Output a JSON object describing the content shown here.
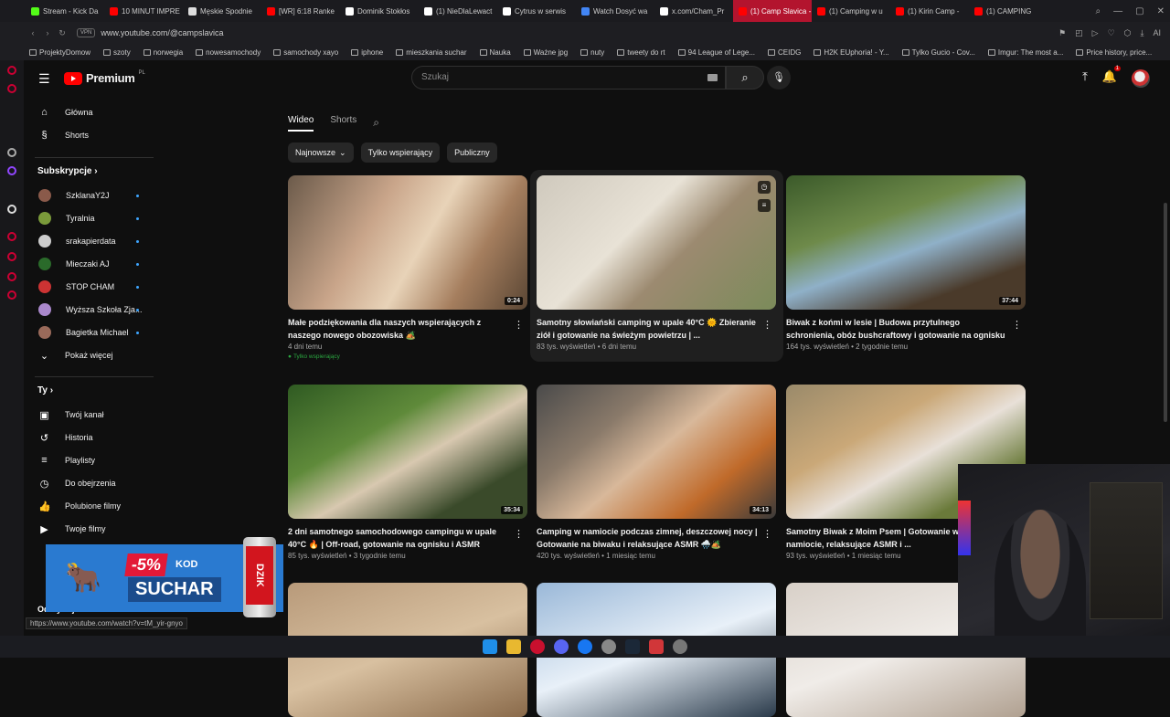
{
  "browser": {
    "tabs": [
      {
        "label": "Stream - Kick Da",
        "color": "#53fc18"
      },
      {
        "label": "10 MINUT IMPRE",
        "color": "#ff0000"
      },
      {
        "label": "Męskie Spodnie",
        "color": "#dddddd"
      },
      {
        "label": "[WR] 6:18 Ranke",
        "color": "#ff0000"
      },
      {
        "label": "Dominik Stokłos",
        "color": "#ffffff"
      },
      {
        "label": "(1) NieDlaLewact",
        "color": "#ffffff"
      },
      {
        "label": "Cytrus w serwis",
        "color": "#ffffff"
      },
      {
        "label": "Watch Dosyć wa",
        "color": "#4285f4"
      },
      {
        "label": "x.com/Cham_Pr",
        "color": "#ffffff"
      },
      {
        "label": "(1) Camp Slavica - YouTube",
        "color": "#ff0000",
        "active": true
      },
      {
        "label": "(1) Camping w u",
        "color": "#ff0000"
      },
      {
        "label": "(1) Kirin Camp -",
        "color": "#ff0000"
      },
      {
        "label": "(1) CAMPING",
        "color": "#ff0000"
      }
    ],
    "vpn": "VPN",
    "url": "www.youtube.com/@campslavica",
    "bookmarks": [
      "ProjektyDomow",
      "szoty",
      "norwegia",
      "nowesamochody",
      "samochody xayo",
      "iphone",
      "mieszkania suchar",
      "Nauka",
      "Ważne jpg",
      "nuty",
      "tweety do rt",
      "94 League of Lege...",
      "CEIDG",
      "H2K EUphoria! - Y...",
      "Tylko Gucio - Cov...",
      "Imgur: The most a...",
      "Price history, price..."
    ],
    "ai_label": "AI",
    "status_url": "https://www.youtube.com/watch?v=tM_yir-gnyo"
  },
  "header": {
    "logo": "Premium",
    "region": "PL",
    "search_placeholder": "Szukaj",
    "notif_count": "1"
  },
  "sidebar": {
    "main": [
      {
        "label": "Główna",
        "icon": "home-icon",
        "glyph": "⌂"
      },
      {
        "label": "Shorts",
        "icon": "shorts-icon",
        "glyph": "§"
      }
    ],
    "subs_title": "Subskrypcje",
    "subs": [
      {
        "label": "SzklanaY2J",
        "color": "#8a5a4a"
      },
      {
        "label": "Tyralnia",
        "color": "#7a9a3a"
      },
      {
        "label": "srakapierdata",
        "color": "#ccc"
      },
      {
        "label": "Mieczaki AJ",
        "color": "#2a6a2a"
      },
      {
        "label": "STOP CHAM",
        "color": "#c33"
      },
      {
        "label": "Wyższa Szkoła Zja...",
        "color": "#aa88cc"
      },
      {
        "label": "Bagietka Michael",
        "color": "#9a6a5a"
      }
    ],
    "more_label": "Pokaż więcej",
    "you_title": "Ty",
    "you": [
      {
        "label": "Twój kanał",
        "icon": "channel-icon",
        "glyph": "▣"
      },
      {
        "label": "Historia",
        "icon": "history-icon",
        "glyph": "↺"
      },
      {
        "label": "Playlisty",
        "icon": "playlist-icon",
        "glyph": "≡"
      },
      {
        "label": "Do obejrzenia",
        "icon": "watch-later-icon",
        "glyph": "◷"
      },
      {
        "label": "Polubione filmy",
        "icon": "like-icon",
        "glyph": "👍"
      },
      {
        "label": "Twoje filmy",
        "icon": "your-videos-icon",
        "glyph": "▶"
      }
    ],
    "bottom_label": "Odkrywaj"
  },
  "channel_tabs": [
    "Wideo",
    "Shorts"
  ],
  "filters": [
    "Najnowsze",
    "Tylko wspierający",
    "Publiczny"
  ],
  "videos": [
    {
      "title": "Małe podziękowania dla naszych wspierających z naszego nowego obozowiska 🏕️",
      "meta": "4 dni temu",
      "duration": "0:24",
      "badge": "Tylko wspierający",
      "bg": "linear-gradient(120deg,#6b5a4a,#c9a58a 35%,#e8d3b8 55%,#a57e5e 75%,#5a4634)"
    },
    {
      "title": "Samotny słowiański camping w upale 40°C 🌞 Zbieranie ziół i gotowanie na świeżym powietrzu | ...",
      "meta": "83 tys. wyświetleń • 6 dni temu",
      "duration": "",
      "badge": "",
      "bg": "linear-gradient(135deg,#cfc9bd,#e8e2d6 40%,#9c8a70 60%,#7b8b5a)"
    },
    {
      "title": "Biwak z końmi w lesie | Budowa przytulnego schronienia, obóz bushcraftowy i gotowanie na ognisku",
      "meta": "164 tys. wyświetleń • 2 tygodnie temu",
      "duration": "37:44",
      "badge": "",
      "bg": "linear-gradient(160deg,#3b5a2a,#6e8a4a 35%,#8fb0c8 55%,#4a3a2a 80%)"
    },
    {
      "title": "2 dni samotnego samochodowego campingu w upale 40°C 🔥 | Off-road, gotowanie na ognisku i ASMR",
      "meta": "85 tys. wyświetleń • 3 tygodnie temu",
      "duration": "35:34",
      "badge": "",
      "bg": "linear-gradient(150deg,#2f5a22,#5f8a3a 35%,#d8c8b0 55%,#3a4a2a 80%)"
    },
    {
      "title": "Camping w namiocie podczas zimnej, deszczowej nocy | Gotowanie na biwaku i relaksujące ASMR 🌧️🏕️",
      "meta": "420 tys. wyświetleń • 1 miesiąc temu",
      "duration": "34:13",
      "badge": "",
      "bg": "linear-gradient(140deg,#4a4a4a,#8a7a6a 30%,#d8b89a 50%,#c06a2a 75%,#3a3a3a)"
    },
    {
      "title": "Samotny Biwak z Moim Psem | Gotowanie w przytulnym namiocie, relaksujące ASMR i ...",
      "meta": "93 tys. wyświetleń • 1 miesiąc temu",
      "duration": "",
      "badge": "",
      "bg": "linear-gradient(150deg,#9a8a6a,#caa878 35%,#e8e0d8 55%,#6a7a3a 80%)"
    },
    {
      "title": "",
      "meta": "",
      "duration": "",
      "badge": "",
      "bg": "linear-gradient(160deg,#b89a7a,#d8c0a0 50%,#8a6a4a)"
    },
    {
      "title": "",
      "meta": "",
      "duration": "",
      "badge": "",
      "bg": "linear-gradient(160deg,#9ab8d8,#e8f0f8 50%,#2a3a4a)"
    },
    {
      "title": "",
      "meta": "",
      "duration": "",
      "badge": "",
      "bg": "linear-gradient(160deg,#d8d0c8,#f0ece8 50%,#b0a090)"
    }
  ],
  "promo": {
    "discount": "-5%",
    "kod": "KOD",
    "code": "SUCHAR",
    "brand": "DZIK"
  }
}
